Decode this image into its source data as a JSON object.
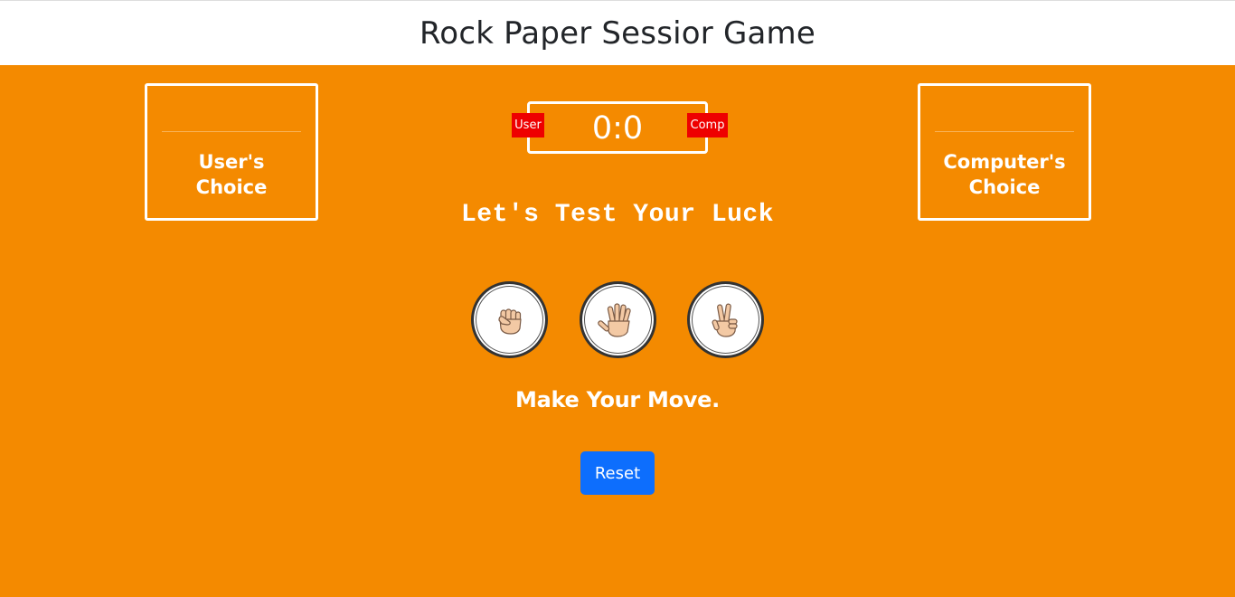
{
  "header": {
    "title": "Rock Paper Sessior Game"
  },
  "user_choice": {
    "label_line1": "User's",
    "label_line2": "Choice"
  },
  "computer_choice": {
    "label_line1": "Computer's",
    "label_line2": "Choice"
  },
  "scoreboard": {
    "score": "0:0",
    "user_badge": "User",
    "comp_badge": "Comp"
  },
  "luck_text": "Let's Test Your Luck",
  "moves": [
    {
      "name": "rock",
      "icon": "fist-hand-icon"
    },
    {
      "name": "paper",
      "icon": "open-hand-icon"
    },
    {
      "name": "scissors",
      "icon": "victory-hand-icon"
    }
  ],
  "status_text": "Make Your Move.",
  "reset_label": "Reset",
  "colors": {
    "background": "#f48a00",
    "badge": "#ee0000",
    "reset_button": "#0d6efd",
    "skin": "#f3c9a4"
  }
}
